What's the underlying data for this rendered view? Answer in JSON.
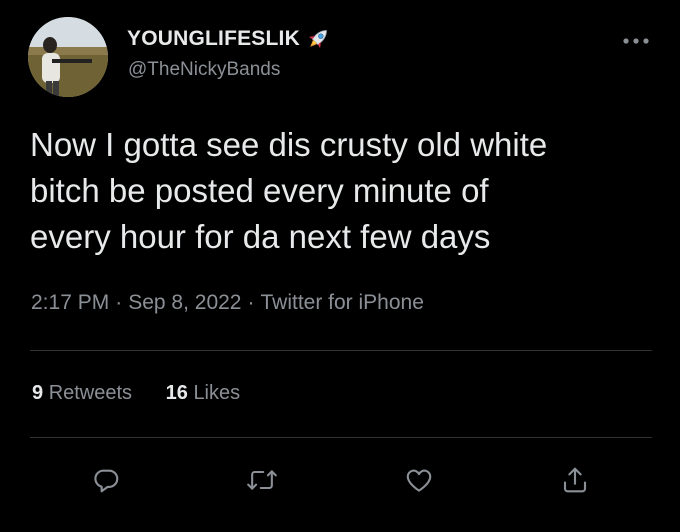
{
  "author": {
    "display_name": "YOUNGLIFESLIK",
    "name_emoji": "rocket-icon",
    "handle": "@TheNickyBands",
    "avatar": "profile-photo"
  },
  "tweet": {
    "lines": [
      "Now I gotta see dis crusty old white",
      "bitch be posted every minute of",
      "every hour for da next few days"
    ]
  },
  "meta": {
    "time": "2:17 PM",
    "separator": "·",
    "date": "Sep 8, 2022",
    "source": "Twitter for iPhone"
  },
  "stats": {
    "retweets_count": "9",
    "retweets_label": "Retweets",
    "likes_count": "16",
    "likes_label": "Likes"
  },
  "actions": [
    "reply-icon",
    "retweet-icon",
    "like-icon",
    "share-icon"
  ],
  "colors": {
    "background": "#000000",
    "text": "#e7e9ea",
    "secondary": "#8b9096",
    "divider": "#2f3336"
  }
}
